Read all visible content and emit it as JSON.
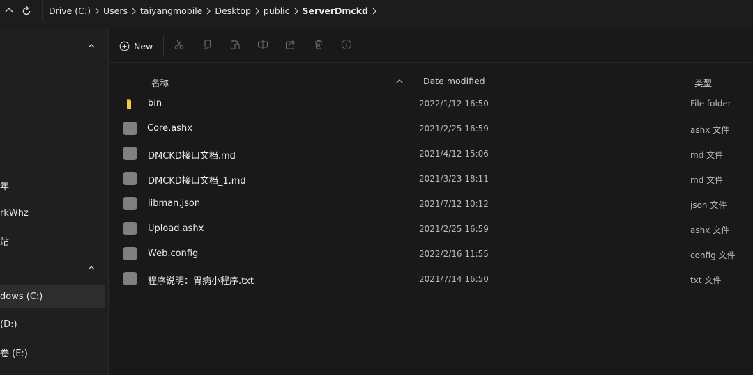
{
  "address": {
    "crumbs": [
      "Drive (C:)",
      "Users",
      "taiyangmobile",
      "Desktop",
      "public",
      "ServerDmckd"
    ]
  },
  "sidebar": {
    "items": [
      {
        "label": "年"
      },
      {
        "label": "rkWhz"
      },
      {
        "label": "站"
      },
      {
        "label": "dows (C:)"
      },
      {
        "label": " (D:)"
      },
      {
        "label": "卷 (E:)"
      }
    ]
  },
  "toolbar": {
    "new_label": "New"
  },
  "columns": {
    "name": "名称",
    "date": "Date modified",
    "type": "类型"
  },
  "files": [
    {
      "name": "bin",
      "date": "2022/1/12 16:50",
      "type": "File folder",
      "icon": "folder-icon"
    },
    {
      "name": "Core.ashx",
      "date": "2021/2/25 16:59",
      "type": "ashx 文件",
      "icon": "file-icon"
    },
    {
      "name": "DMCKD接口文档.md",
      "date": "2021/4/12 15:06",
      "type": "md 文件",
      "icon": "file-icon"
    },
    {
      "name": "DMCKD接口文档_1.md",
      "date": "2021/3/23 18:11",
      "type": "md 文件",
      "icon": "file-icon"
    },
    {
      "name": "libman.json",
      "date": "2021/7/12 10:12",
      "type": "json 文件",
      "icon": "file-icon"
    },
    {
      "name": "Upload.ashx",
      "date": "2021/2/25 16:59",
      "type": "ashx 文件",
      "icon": "file-icon"
    },
    {
      "name": "Web.config",
      "date": "2022/2/16 11:55",
      "type": "config 文件",
      "icon": "file-icon"
    },
    {
      "name": "程序说明：胃病小程序.txt",
      "date": "2021/7/14 16:50",
      "type": "txt 文件",
      "icon": "file-icon"
    }
  ],
  "colors": {
    "background": "#191919",
    "sidebar": "#1f1f1f",
    "folder": "#f2c94c",
    "file": "#808080"
  }
}
